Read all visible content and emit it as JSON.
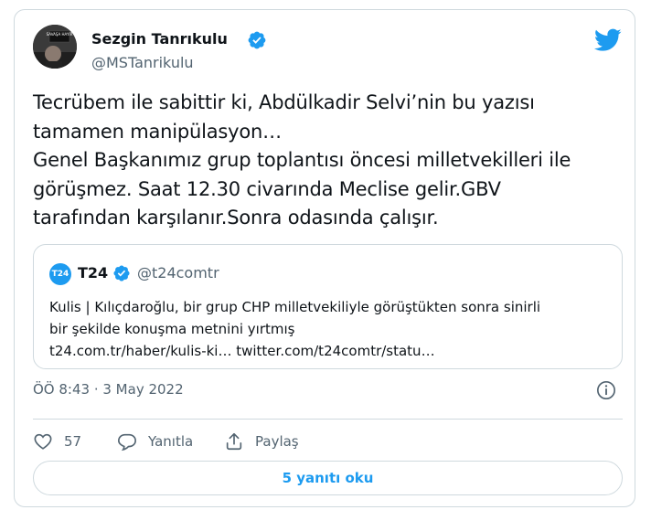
{
  "author": {
    "name": "Sezgin Tanrıkulu",
    "handle": "@MSTanrikulu",
    "verified": true,
    "avatar_banner_text": "SAVAŞA HAYIR"
  },
  "tweet": {
    "lines": [
      "Tecrübem ile sabittir ki, Abdülkadir Selvi’nin bu yazısı",
      "tamamen manipülasyon…",
      "Genel Başkanımız grup toplantısı öncesi milletvekilleri ile",
      "görüşmez. Saat 12.30 civarında Meclise gelir.GBV",
      "tarafından karşılanır.Sonra odasında çalışır."
    ]
  },
  "quoted": {
    "avatar_text": "T24",
    "name": "T24",
    "handle": "@t24comtr",
    "verified": true,
    "lines": [
      "Kulis | Kılıçdaroğlu, bir grup CHP milletvekiliyle görüştükten sonra sinirli",
      "bir şekilde konuşma metnini yırtmış",
      "t24.com.tr/haber/kulis-ki… twitter.com/t24comtr/statu…"
    ]
  },
  "timestamp": "ÖÖ 8:43 · 3 May 2022",
  "actions": {
    "like_count": "57",
    "reply_label": "Yanıtla",
    "share_label": "Paylaş"
  },
  "replies_button_label": "5 yanıtı oku",
  "colors": {
    "brand_blue": "#1d9bf0",
    "like_red": "#f91880",
    "secondary_text": "#536471",
    "border": "#cfd9de"
  }
}
